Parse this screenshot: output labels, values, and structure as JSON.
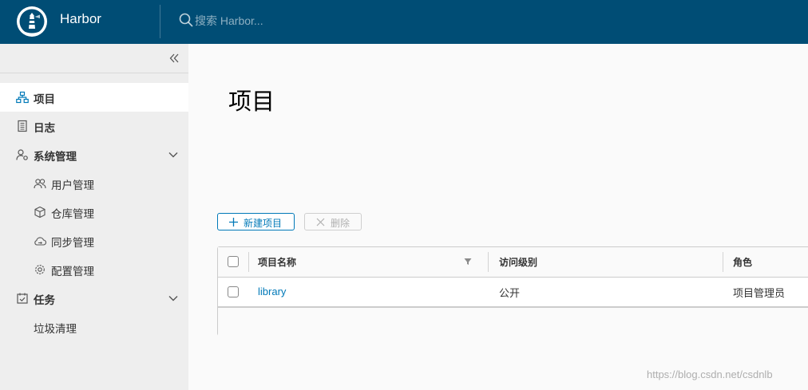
{
  "header": {
    "app_name": "Harbor",
    "search_placeholder": "搜索 Harbor...",
    "bg_color": "#004d75"
  },
  "sidebar": {
    "collapse_icon": "double-chevron-left-icon",
    "items": [
      {
        "label": "项目",
        "icon": "project-tree-icon",
        "active": true
      },
      {
        "label": "日志",
        "icon": "log-document-icon"
      },
      {
        "label": "系统管理",
        "icon": "user-gear-icon",
        "expanded": true
      },
      {
        "label": "用户管理",
        "icon": "users-icon"
      },
      {
        "label": "仓库管理",
        "icon": "cube-icon"
      },
      {
        "label": "同步管理",
        "icon": "cloud-sync-icon"
      },
      {
        "label": "配置管理",
        "icon": "gear-icon"
      },
      {
        "label": "任务",
        "icon": "calendar-check-icon",
        "expanded": true
      },
      {
        "label": "垃圾清理"
      }
    ]
  },
  "main": {
    "title": "项目",
    "actions": {
      "new_label": "新建项目",
      "delete_label": "删除"
    },
    "table": {
      "columns": [
        "项目名称",
        "访问级别",
        "角色"
      ],
      "rows": [
        {
          "name": "library",
          "access": "公开",
          "role": "项目管理员"
        }
      ]
    }
  },
  "watermark": "https://blog.csdn.net/csdnlb",
  "colors": {
    "accent": "#0079b8",
    "sidebar_bg": "#eeeeee",
    "page_bg": "#fafafa"
  }
}
